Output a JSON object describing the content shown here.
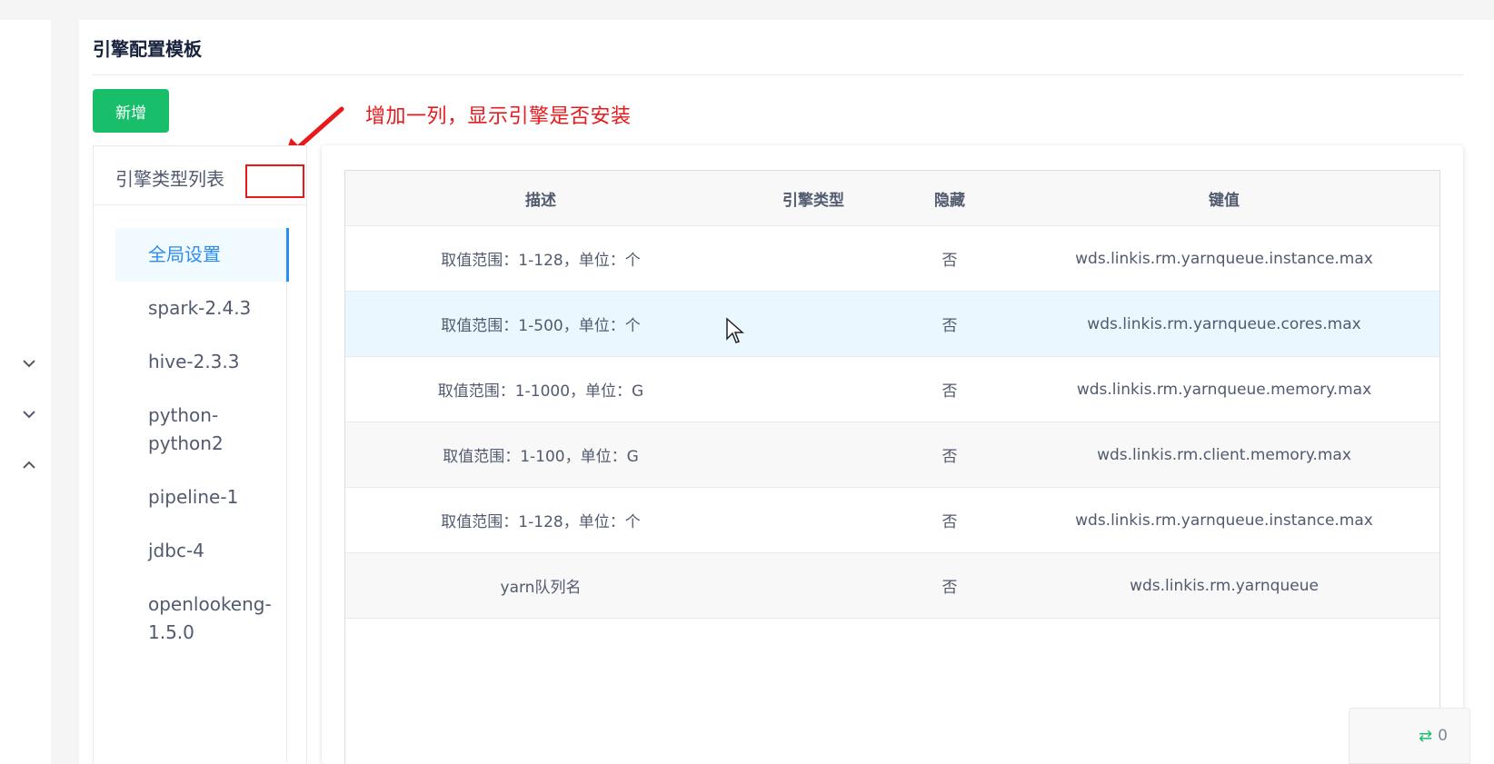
{
  "page": {
    "title": "引擎配置模板",
    "add_button_label": "新增"
  },
  "annotation": {
    "text": "增加一列，显示引擎是否安装",
    "color": "#e8181b"
  },
  "engine_panel": {
    "title": "引擎类型列表",
    "items": [
      {
        "label": "全局设置",
        "active": true
      },
      {
        "label": "spark-2.4.3",
        "active": false
      },
      {
        "label": "hive-2.3.3",
        "active": false
      },
      {
        "label": "python-python2",
        "active": false
      },
      {
        "label": "pipeline-1",
        "active": false
      },
      {
        "label": "jdbc-4",
        "active": false
      },
      {
        "label": "openlookeng-1.5.0",
        "active": false
      }
    ]
  },
  "table": {
    "columns": [
      "描述",
      "引擎类型",
      "隐藏",
      "键值"
    ],
    "rows": [
      {
        "desc": "取值范围：1-128，单位：个",
        "engine_type": "",
        "hidden": "否",
        "key": "wds.linkis.rm.yarnqueue.instance.max"
      },
      {
        "desc": "取值范围：1-500，单位：个",
        "engine_type": "",
        "hidden": "否",
        "key": "wds.linkis.rm.yarnqueue.cores.max"
      },
      {
        "desc": "取值范围：1-1000，单位：G",
        "engine_type": "",
        "hidden": "否",
        "key": "wds.linkis.rm.yarnqueue.memory.max"
      },
      {
        "desc": "取值范围：1-100，单位：G",
        "engine_type": "",
        "hidden": "否",
        "key": "wds.linkis.rm.client.memory.max"
      },
      {
        "desc": "取值范围：1-128，单位：个",
        "engine_type": "",
        "hidden": "否",
        "key": "wds.linkis.rm.yarnqueue.instance.max"
      },
      {
        "desc": "yarn队列名",
        "engine_type": "",
        "hidden": "否",
        "key": "wds.linkis.rm.yarnqueue"
      }
    ]
  },
  "float_widget": {
    "icon": "swap-arrows-icon",
    "count": "0"
  },
  "colors": {
    "accent": "#2d8cf0",
    "success": "#19be6b",
    "annotation": "#e8181b"
  }
}
